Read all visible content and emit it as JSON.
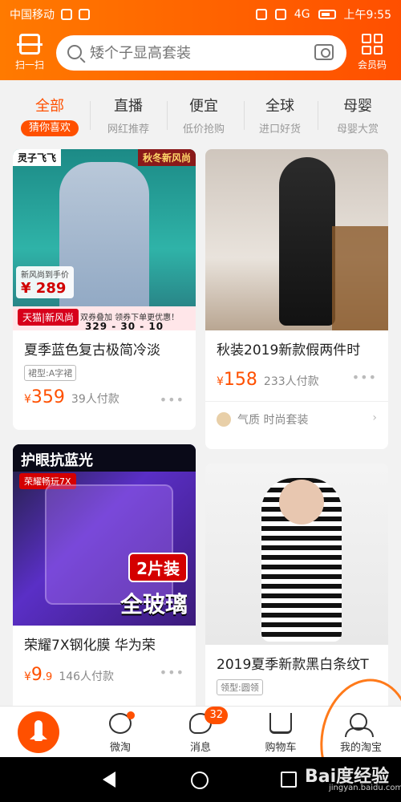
{
  "status_bar": {
    "carrier": "中国移动",
    "time": "上午9:55",
    "signal": "4G"
  },
  "header": {
    "scan_label": "扫一扫",
    "search_placeholder": "矮个子显高套装",
    "member_label": "会员码"
  },
  "tabs": [
    {
      "title": "全部",
      "subtitle": "猜你喜欢",
      "active": true
    },
    {
      "title": "直播",
      "subtitle": "网红推荐"
    },
    {
      "title": "便宜",
      "subtitle": "低价抢购"
    },
    {
      "title": "全球",
      "subtitle": "进口好货"
    },
    {
      "title": "母婴",
      "subtitle": "母婴大赏"
    }
  ],
  "products": {
    "p1": {
      "title": "夏季蓝色复古极简冷淡",
      "tag": "裙型:A字裙",
      "currency": "¥",
      "price": "359",
      "paid": "39人付款",
      "promo": {
        "left_badge": "灵子飞飞",
        "right_badge": "秋冬新风尚",
        "to_hand_label": "新风尚到手价",
        "to_hand_price": "¥ 289",
        "tmall": "天猫|新风尚",
        "line": "双券叠加 领券下单更优惠！",
        "dates": "329 - 30 - 10"
      }
    },
    "p2": {
      "title": "秋装2019新款假两件时",
      "currency": "¥",
      "price": "158",
      "paid": "233人付款",
      "style_text": "气质 时尚套装"
    },
    "p3": {
      "title": "荣耀7X钢化膜 华为荣",
      "currency": "¥",
      "price_int": "9",
      "price_dec": ".9",
      "paid": "146人付款",
      "promo": {
        "headline": "护眼抗蓝光",
        "model_tag": "荣耀畅玩7X",
        "pack": "2片装",
        "glass": "全玻璃"
      }
    },
    "p4": {
      "title": "2019夏季新款黑白条纹T",
      "tag": "领型:圆领"
    }
  },
  "bottom_nav": {
    "items": [
      {
        "label": "微淘"
      },
      {
        "label": "消息",
        "badge": "32"
      },
      {
        "label": "购物车"
      },
      {
        "label": "我的淘宝"
      }
    ]
  },
  "watermark": {
    "main": "Bai度经验",
    "sub": "jingyan.baidu.com"
  },
  "colors": {
    "accent": "#ff5000",
    "header_start": "#ff7a00",
    "header_end": "#ff4f00"
  }
}
